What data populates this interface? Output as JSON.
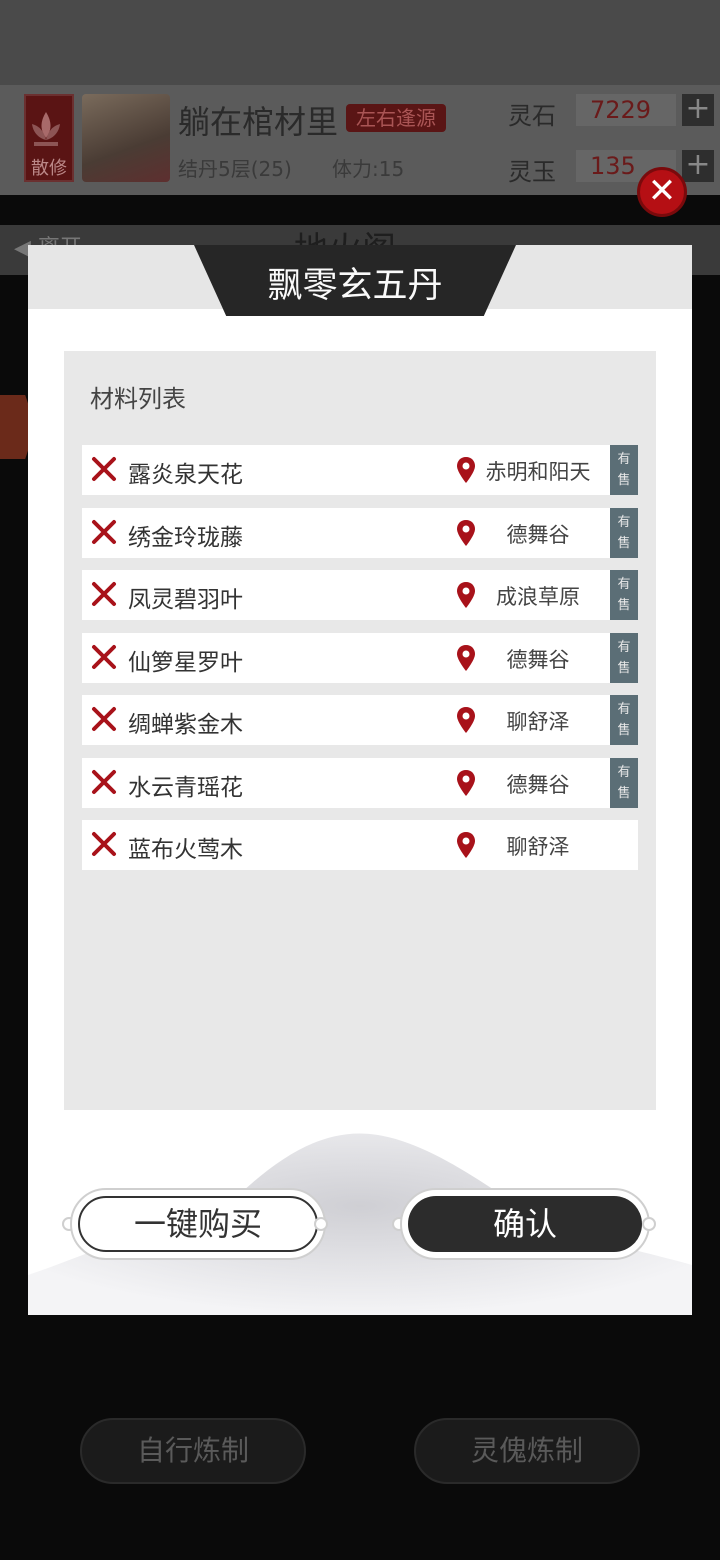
{
  "header": {
    "sect_badge": "散修",
    "player_name": "躺在棺材里",
    "player_title": "左右逢源",
    "realm": "结丹5层(25)",
    "stamina": "体力:15",
    "currencies": [
      {
        "label": "灵石",
        "value": "7229",
        "plus": "+"
      },
      {
        "label": "灵玉",
        "value": "135",
        "plus": "+"
      }
    ]
  },
  "background": {
    "nav_title": "地火阁",
    "back_label": "离开",
    "bottom_buttons": [
      "自行炼制",
      "灵傀炼制"
    ]
  },
  "dialog": {
    "title": "飘零玄五丹",
    "close_label": "✕",
    "panel_title": "材料列表",
    "materials": [
      {
        "name": "露炎泉天花",
        "location": "赤明和阳天",
        "sale": "有售"
      },
      {
        "name": "绣金玲珑藤",
        "location": "德舞谷",
        "sale": "有售"
      },
      {
        "name": "凤灵碧羽叶",
        "location": "成浪草原",
        "sale": "有售"
      },
      {
        "name": "仙箩星罗叶",
        "location": "德舞谷",
        "sale": "有售"
      },
      {
        "name": "绸蝉紫金木",
        "location": "聊舒泽",
        "sale": "有售"
      },
      {
        "name": "水云青瑶花",
        "location": "德舞谷",
        "sale": "有售"
      },
      {
        "name": "蓝布火莺木",
        "location": "聊舒泽",
        "sale": ""
      }
    ],
    "buy_all_label": "一键购买",
    "confirm_label": "确认"
  },
  "colors": {
    "accent_red": "#b50f14",
    "sale_tag": "#5b6e76",
    "panel_bg": "#e8e8e8",
    "title_tab": "#262626"
  },
  "icons": {
    "remove": "x-icon",
    "location": "pin-icon",
    "close": "close-icon"
  }
}
